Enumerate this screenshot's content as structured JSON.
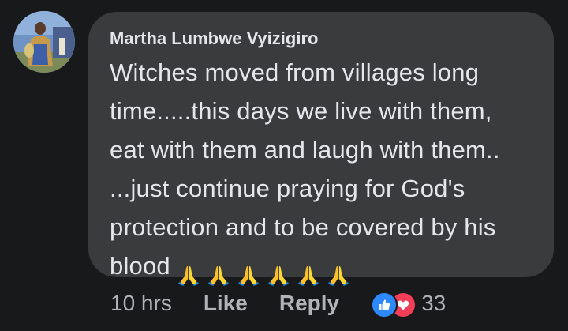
{
  "comment": {
    "author": "Martha Lumbwe Vyizigiro",
    "lines": [
      "Witches moved from villages long",
      "time.....this days we live with them,",
      "eat with them and laugh with them..",
      "...just continue praying for God's",
      "protection and to be covered by his",
      "blood"
    ],
    "emojis": [
      "🙏",
      "🙏",
      "🙏",
      "🙏",
      "🙏",
      "🙏"
    ]
  },
  "actions": {
    "time": "10 hrs",
    "like_label": "Like",
    "reply_label": "Reply",
    "reaction_icons": [
      "like-icon",
      "love-icon"
    ],
    "reaction_count": "33"
  },
  "colors": {
    "page_background": "#18191a",
    "bubble_background": "#3a3b3c",
    "primary_text": "#e4e6eb",
    "secondary_text": "#b0b3b8",
    "like_blue": "#2e89ff",
    "love_red": "#f33e58"
  }
}
